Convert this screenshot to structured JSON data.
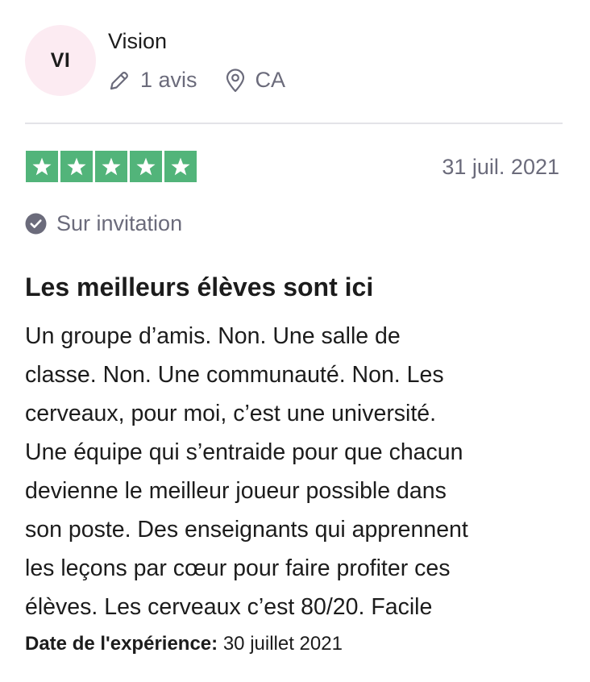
{
  "reviewer": {
    "initials": "VI",
    "name": "Vision",
    "reviews_count": "1 avis",
    "country": "CA",
    "avatar_color": "#fcebf2"
  },
  "review": {
    "rating": 5,
    "max_rating": 5,
    "star_color": "#52b47a",
    "date": "31 juil. 2021",
    "invitation_label": "Sur invitation",
    "title": "Les meilleurs élèves sont ici",
    "body_lines": [
      "Un groupe d’amis. Non. Une salle de",
      "classe. Non. Une communauté. Non. Les",
      "cerveaux, pour moi, c’est une université.",
      "Une équipe qui s’entraide pour que chacun",
      "devienne le meilleur joueur possible dans",
      "son poste. Des enseignants qui apprennent",
      "les leçons par cœur pour faire profiter ces",
      "élèves. Les cerveaux c’est 80/20. Facile"
    ],
    "experience_label": "Date de l'expérience:",
    "experience_date": "30 juillet 2021"
  },
  "icons": {
    "reviews": "pencil-icon",
    "location": "location-pin-icon",
    "invitation": "check-circle-icon",
    "star": "star-icon"
  }
}
